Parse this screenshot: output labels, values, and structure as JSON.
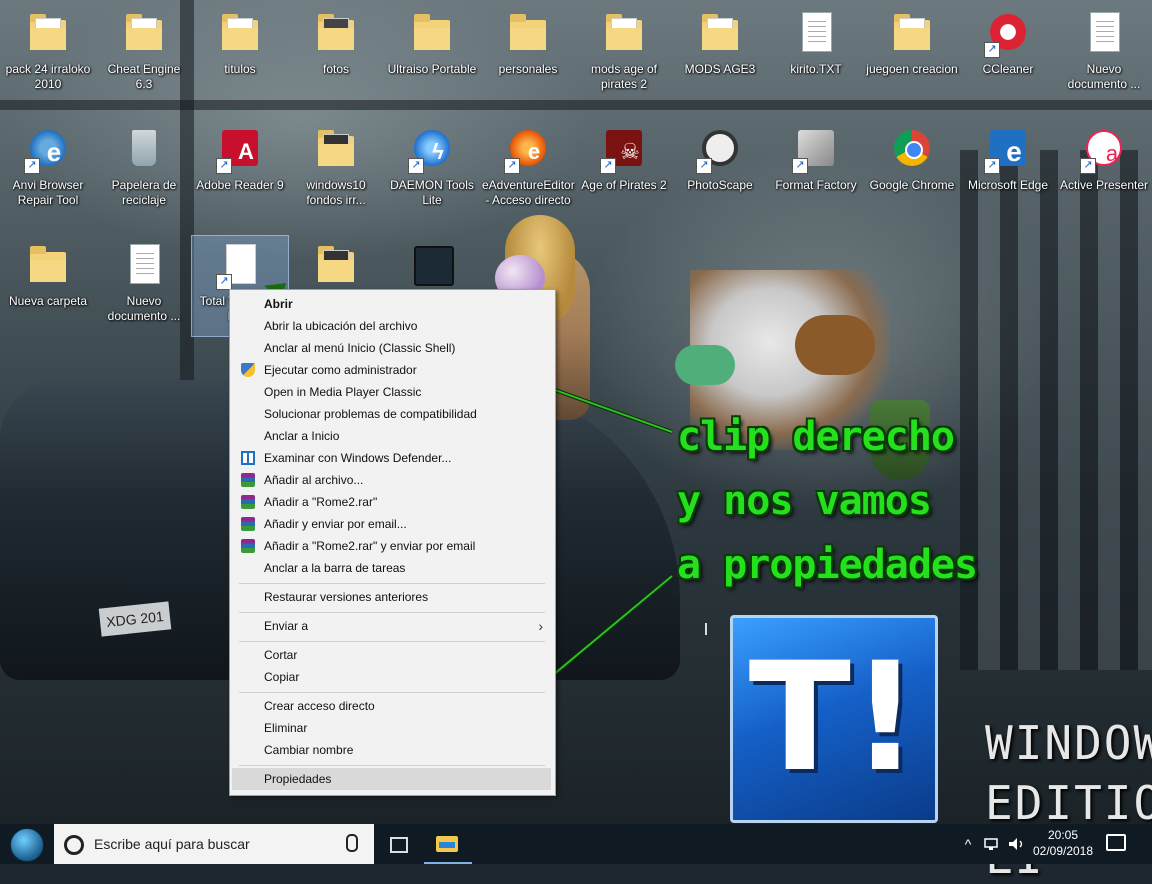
{
  "desktop_icons": [
    {
      "label": "pack 24  irraloko 2010",
      "type": "folder"
    },
    {
      "label": "Cheat Engine 6.3",
      "type": "folder"
    },
    {
      "label": "titulos",
      "type": "folder-doc"
    },
    {
      "label": "fotos",
      "type": "folder"
    },
    {
      "label": "Ultraiso Portable",
      "type": "folder"
    },
    {
      "label": "personales",
      "type": "folder"
    },
    {
      "label": "mods age of pirates 2",
      "type": "folder"
    },
    {
      "label": "MODS AGE3",
      "type": "folder"
    },
    {
      "label": "kirito.TXT",
      "type": "document"
    },
    {
      "label": "juegoen creacion",
      "type": "folder"
    },
    {
      "label": "CCleaner",
      "type": "app"
    },
    {
      "label": "Nuevo documento ...",
      "type": "document"
    },
    {
      "label": "Anvi Browser Repair Tool",
      "type": "app"
    },
    {
      "label": "Papelera de reciclaje",
      "type": "recycle-bin"
    },
    {
      "label": "Adobe Reader 9",
      "type": "app"
    },
    {
      "label": "windows10 fondos irr...",
      "type": "folder"
    },
    {
      "label": "DAEMON Tools Lite",
      "type": "app"
    },
    {
      "label": "eAdventureEditor - Acceso directo",
      "type": "app"
    },
    {
      "label": "Age of Pirates 2",
      "type": "app"
    },
    {
      "label": "PhotoScape",
      "type": "app"
    },
    {
      "label": "Format Factory",
      "type": "app"
    },
    {
      "label": "Google Chrome",
      "type": "app"
    },
    {
      "label": "Microsoft Edge",
      "type": "app"
    },
    {
      "label": "Active Presenter",
      "type": "app"
    },
    {
      "label": "Nueva carpeta",
      "type": "folder"
    },
    {
      "label": "Nuevo documento ...",
      "type": "document"
    },
    {
      "label": "Total W... II E... Ed...",
      "type": "document"
    },
    {
      "label": "",
      "type": "folder"
    },
    {
      "label": "",
      "type": "video"
    }
  ],
  "context_menu": {
    "items": [
      {
        "label": "Abrir"
      },
      {
        "label": "Abrir la ubicación del archivo"
      },
      {
        "label": "Anclar al menú Inicio (Classic Shell)"
      },
      {
        "label": "Ejecutar como administrador"
      },
      {
        "label": "Open in Media Player Classic"
      },
      {
        "label": "Solucionar problemas de compatibilidad"
      },
      {
        "label": "Anclar a Inicio"
      },
      {
        "label": "Examinar con Windows Defender..."
      },
      {
        "label": "Añadir al archivo..."
      },
      {
        "label": "Añadir a \"Rome2.rar\""
      },
      {
        "label": "Añadir y enviar por email..."
      },
      {
        "label": "Añadir a \"Rome2.rar\" y enviar por email"
      },
      {
        "label": "Anclar a la barra de tareas"
      },
      {
        "label": "Restaurar versiones anteriores"
      },
      {
        "label": "Enviar a"
      },
      {
        "label": "Cortar"
      },
      {
        "label": "Copiar"
      },
      {
        "label": "Crear acceso directo"
      },
      {
        "label": "Eliminar"
      },
      {
        "label": "Cambiar nombre"
      },
      {
        "label": "Propiedades"
      }
    ]
  },
  "annotation": {
    "lines": [
      "clip derecho",
      "y nos vamos",
      "a propiedades"
    ],
    "color": "#25e01c"
  },
  "logo": {
    "text": "T!"
  },
  "watermark": {
    "line1": "WINDOWS",
    "line2": "EDITION LI"
  },
  "taskbar": {
    "search_placeholder": "Escribe aquí para buscar",
    "clock_time": "20:05",
    "clock_date": "02/09/2018",
    "tray_chevron": "^"
  }
}
